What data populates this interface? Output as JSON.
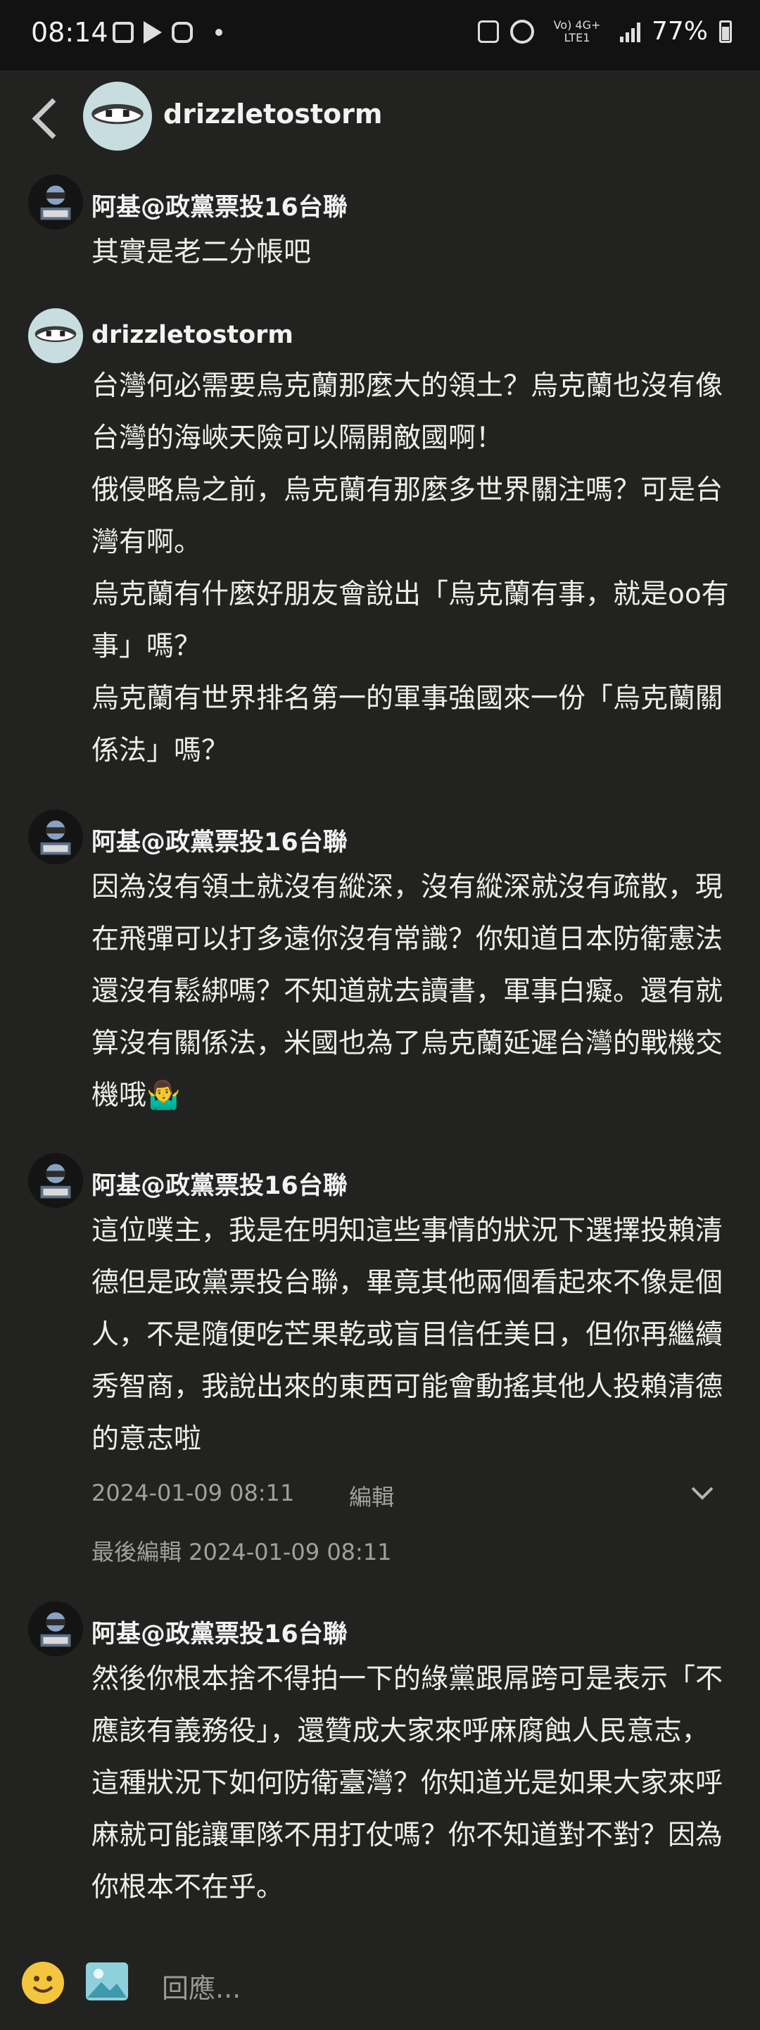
{
  "status": {
    "time": "08:14",
    "network": "Vo) 4G+ LTE1",
    "battery": "77%"
  },
  "header": {
    "username": "drizzletostorm"
  },
  "posts": [
    {
      "author": "阿基@政黨票投16台聯",
      "lines": [
        "其實是老二分帳吧"
      ]
    },
    {
      "author": "drizzletostorm",
      "lines": [
        "台灣何必需要烏克蘭那麼大的領土？烏克蘭也沒有像台灣的海峽天險可以隔開敵國啊！",
        "俄侵略烏之前，烏克蘭有那麼多世界關注嗎？可是台灣有啊。",
        "烏克蘭有什麼好朋友會說出「烏克蘭有事，就是oo有事」嗎？",
        "烏克蘭有世界排名第一的軍事強國來一份「烏克蘭關係法」嗎？"
      ]
    },
    {
      "author": "阿基@政黨票投16台聯",
      "lines": [
        "因為沒有領土就沒有縱深，沒有縱深就沒有疏散，現在飛彈可以打多遠你沒有常識？你知道日本防衛憲法還沒有鬆綁嗎？不知道就去讀書，軍事白癡。還有就算沒有關係法，米國也為了烏克蘭延遲台灣的戰機交機哦🤷‍♂️"
      ]
    },
    {
      "author": "阿基@政黨票投16台聯",
      "lines": [
        "這位噗主，我是在明知這些事情的狀況下選擇投賴清德但是政黨票投台聯，畢竟其他兩個看起來不像是個人，不是隨便吃芒果乾或盲目信任美日，但你再繼續秀智商，我說出來的東西可能會動搖其他人投賴清德的意志啦"
      ],
      "timestamp": "2024-01-09 08:11",
      "edit_label": "編輯",
      "last_edited": "最後編輯 2024-01-09 08:11"
    },
    {
      "author": "阿基@政黨票投16台聯",
      "lines": [
        "然後你根本捨不得拍一下的綠黨跟屌跨可是表示「不應該有義務役」，還贊成大家來呼麻腐蝕人民意志，這種狀況下如何防衛臺灣？你知道光是如果大家來呼麻就可能讓軍隊不用打仗嗎？你不知道對不對？因為你根本不在乎。"
      ]
    }
  ],
  "reply": {
    "placeholder": "回應..."
  }
}
